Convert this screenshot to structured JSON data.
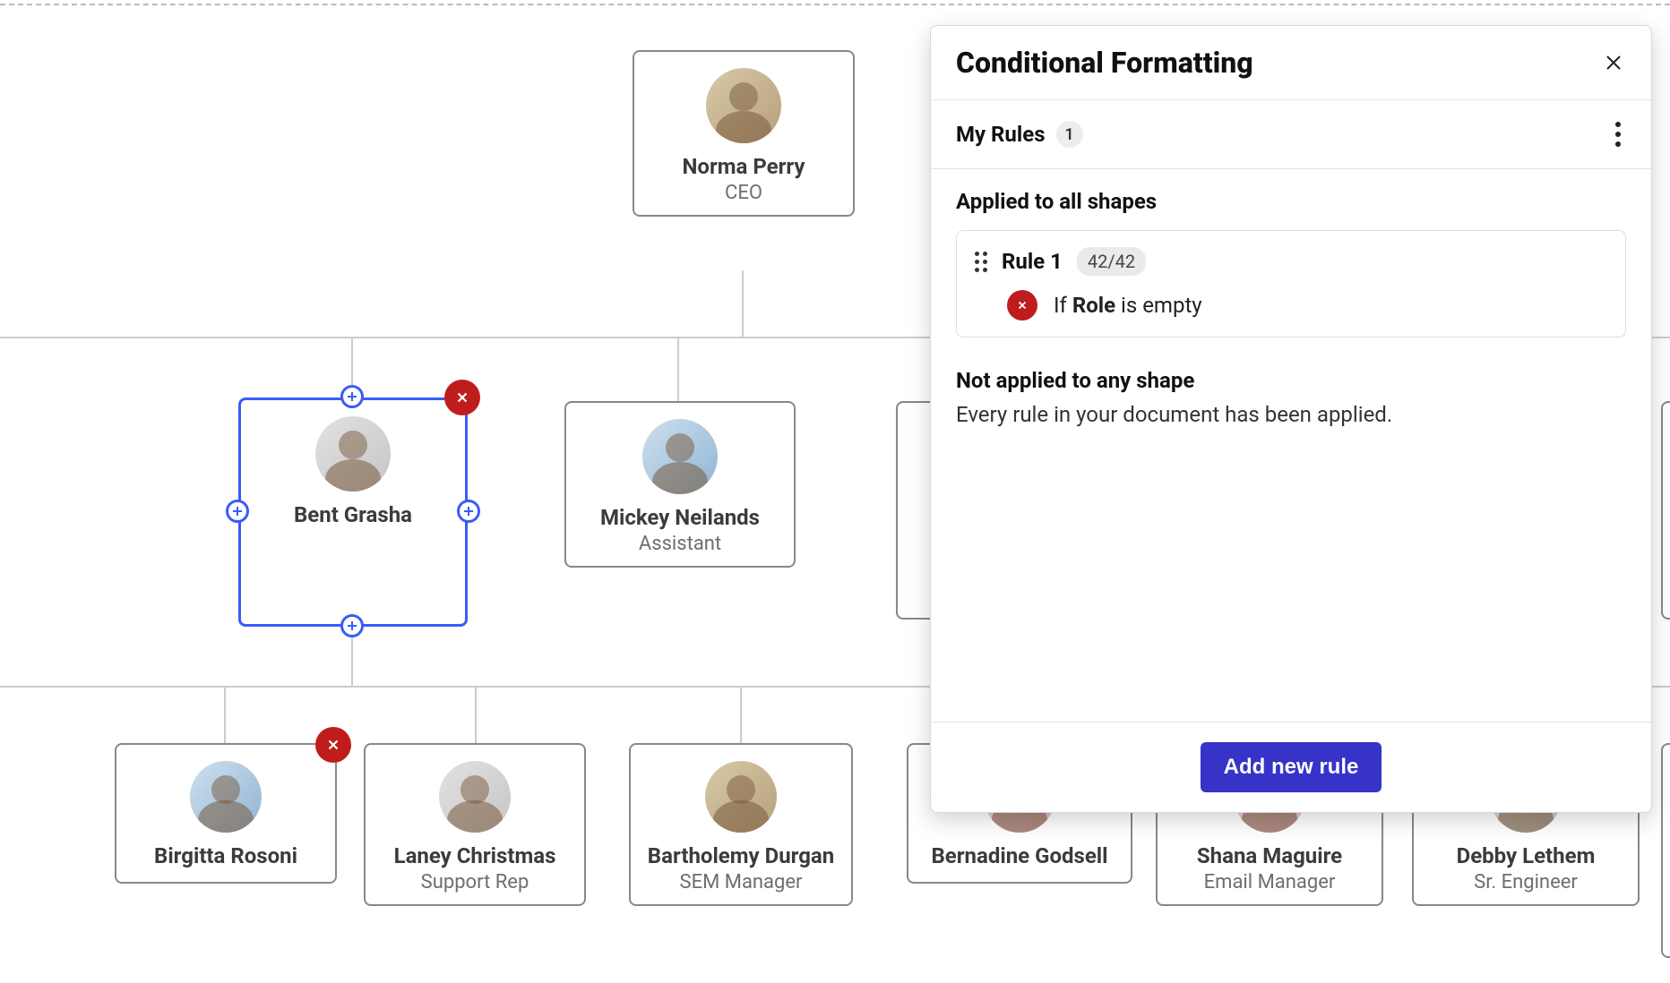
{
  "panel": {
    "title": "Conditional Formatting",
    "my_rules_label": "My Rules",
    "rules_count": "1",
    "applied_heading": "Applied to all shapes",
    "rule": {
      "name": "Rule 1",
      "count": "42/42",
      "cond_prefix": "If ",
      "cond_field": "Role",
      "cond_suffix": " is empty"
    },
    "not_applied_heading": "Not applied to any shape",
    "not_applied_sub": "Every rule in your document has been applied.",
    "add_rule_label": "Add new rule"
  },
  "org": {
    "ceo": {
      "name": "Norma Perry",
      "role": "CEO"
    },
    "row2": [
      {
        "name": "Bent Grasha",
        "role": "",
        "selected": true,
        "error": true
      },
      {
        "name": "Mickey Neilands",
        "role": "Assistant"
      }
    ],
    "row3": [
      {
        "name": "Birgitta Rosoni",
        "role": "",
        "error": true
      },
      {
        "name": "Laney Christmas",
        "role": "Support Rep"
      },
      {
        "name": "Bartholemy Durgan",
        "role": "SEM Manager"
      },
      {
        "name": "Bernadine Godsell",
        "role": ""
      },
      {
        "name": "Shana Maguire",
        "role": "Email Manager"
      },
      {
        "name": "Debby Lethem",
        "role": "Sr. Engineer"
      }
    ]
  }
}
